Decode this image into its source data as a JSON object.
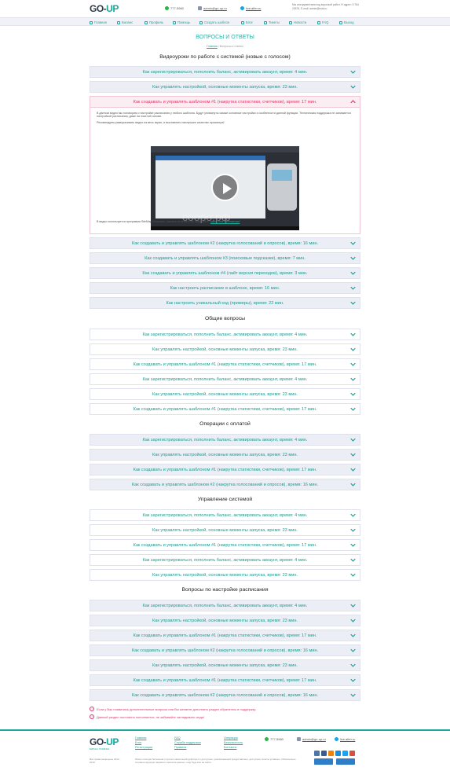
{
  "header": {
    "logo_main": "GO-",
    "logo_accent": "UP",
    "phone": "777-5960",
    "email": "admin@go-up.ru",
    "skype": "live:alfer.ru",
    "note": "Мы инструментами под воронкой работ. Ф адрес: 5 764 20576, E-mail: admin@mail.ru"
  },
  "nav": [
    {
      "label": "Главная",
      "icon": "home-icon"
    },
    {
      "label": "Баланс",
      "icon": "wallet-icon"
    },
    {
      "label": "Профиль",
      "icon": "user-icon"
    },
    {
      "label": "Помощь",
      "icon": "help-icon"
    },
    {
      "label": "Создать шаблон",
      "icon": "plus-icon"
    },
    {
      "label": "Блог",
      "icon": "blog-icon"
    },
    {
      "label": "Тикеты",
      "icon": "ticket-icon"
    },
    {
      "label": "Новости",
      "icon": "news-icon"
    },
    {
      "label": "FAQ",
      "icon": "faq-icon"
    },
    {
      "label": "Выход",
      "icon": "logout-icon"
    }
  ],
  "page": {
    "title": "ВОПРОСЫ И ОТВЕТЫ",
    "crumb_home": "Главная",
    "crumb_current": " / Вопросы и ответы"
  },
  "sections": {
    "s1": "Видеоуроки по работе с системой (новые с голосом)",
    "s2": "Общие вопросы",
    "s3": "Операции с оплатой",
    "s4": "Управление системой",
    "s5": "Вопросы по настройке расписания"
  },
  "q": {
    "a": "Как зарегистрироваться, пополнить баланс, активировать аккаунт, время: 4 мин.",
    "b": "Как управлять настройкой, основные моменты запуска, время: 23 мин.",
    "c": "Как создавать и управлять шаблоном #1 (накрутка статистики, счетчиков), время: 17 мин.",
    "d": "Как создавать и управлять шаблоном #2 (накрутка голосований и опросов), время: 16 мин.",
    "e": "Как создавать и управлять шаблоном #3 (поисковые подсказки), время: 7 мин.",
    "f": "Как создавать и управлять шаблоном #4 (лайт версия переходов), время: 3 мин.",
    "g": "Как настроить расписание в шаблоне, время: 16 мин.",
    "h": "Как настроить уникальный код (примеры), время: 22 мин."
  },
  "open_panel": {
    "p1": "В данном видео мы поговорим о настройке расписания у любого шаблона. Будут упомянуты самые основные настройки и особенности данной функции. Техническая поддержка не занимается настройкой расписания, даже на платной основе.",
    "p2": "Рекомендуем разворачивать видео на весь экран, и выставлять наилучшее качество просмотра!",
    "p3": "В видео используется программа SiteMap Generator, скачать ее можно на офф сайте:",
    "p3_link": "здесь она бесплатная!",
    "video_watermark": "сoopo.рф"
  },
  "notes": {
    "n1": "Если у Вас появились дополнительные вопросы или Вы желаете дополнить раздел обратитесь в поддержку.",
    "n2": "Данный раздел постоянно пополняется, не забывайте заглядывать сюда!"
  },
  "footer": {
    "logo_main": "GO-",
    "logo_accent": "UP",
    "slogan": "БИРЖА ТРАФИКА",
    "copyright": "Все права защищены 2012-2019",
    "col1": [
      "Главная",
      "Блог",
      "Регистрация"
    ],
    "col2": [
      "FAQ",
      "Служба поддержки",
      "Правила"
    ],
    "col3": [
      "Операции",
      "Безопасность",
      "Контакты"
    ],
    "phone": "777-5960",
    "email": "admin@go-up.ru",
    "skype": "live:alfer.ru",
    "legal": "Юзинг позиции биткоинов и прочих накоплений действует в доступное, реализованной предоставлено, доступное поняты уставных. Обязательно сгорание функции задания и анализа данных. ещё будь всё на сайте."
  },
  "colors": {
    "accent": "#1aa89a",
    "open": "#e0336a",
    "row": "#eceef6"
  }
}
